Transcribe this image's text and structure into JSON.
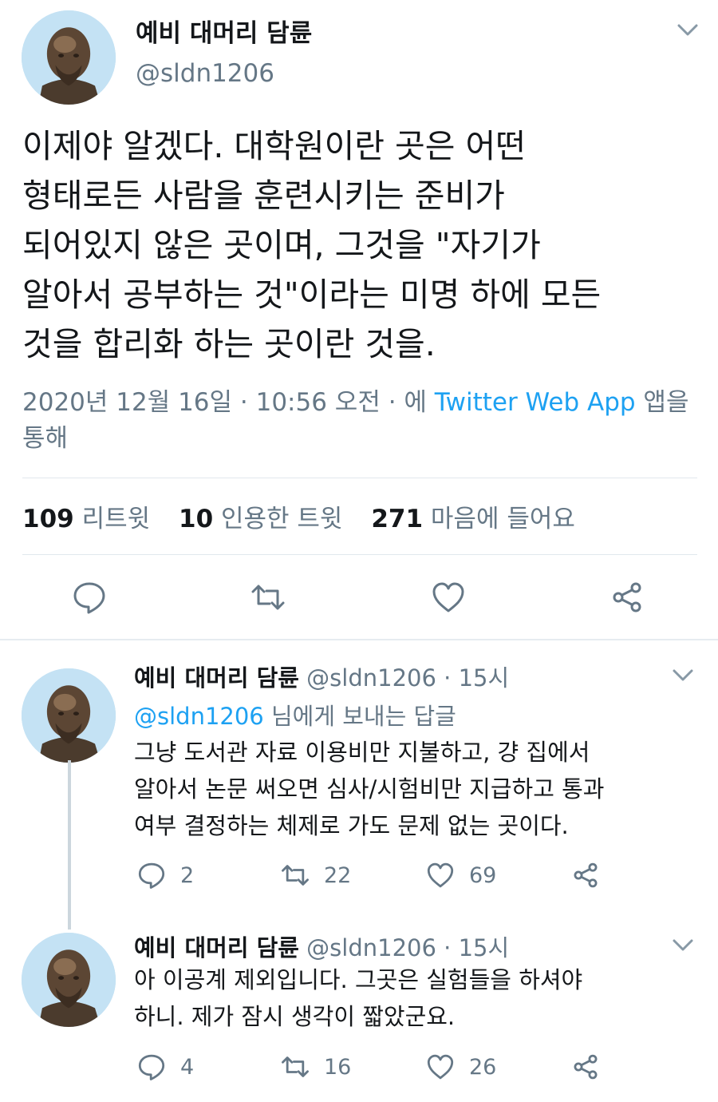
{
  "main_tweet": {
    "display_name": "예비 대머리 담륜",
    "handle": "@sldn1206",
    "text": "이제야 알겠다. 대학원이란 곳은 어떤\n형태로든 사람을 훈련시키는 준비가\n되어있지 않은 곳이며, 그것을 \"자기가\n알아서 공부하는 것\"이라는 미명 하에 모든\n것을 합리화 하는 곳이란 것을.",
    "timestamp": "2020년 12월 16일 · 10:56 오전 · 에",
    "source_app": "Twitter Web App",
    "source_suffix": "앱을",
    "source_suffix2": "통해",
    "stats": {
      "retweets_count": "109",
      "retweets_label": "리트윗",
      "quotes_count": "10",
      "quotes_label": "인용한 트윗",
      "likes_count": "271",
      "likes_label": "마음에 들어요"
    }
  },
  "replies": [
    {
      "display_name": "예비 대머리 담륜",
      "handle": "@sldn1206",
      "time": "· 15시",
      "replying_to_handle": "@sldn1206",
      "replying_to_suffix": "님에게 보내는 답글",
      "text": "그냥 도서관 자료 이용비만 지불하고, 걍 집에서\n알아서 논문 써오면 심사/시험비만 지급하고 통과\n여부 결정하는 체제로 가도 문제 없는 곳이다.",
      "reply_count": "2",
      "retweet_count": "22",
      "like_count": "69"
    },
    {
      "display_name": "예비 대머리 담륜",
      "handle": "@sldn1206",
      "time": "· 15시",
      "text": "아 이공계 제외입니다. 그곳은 실험들을 하셔야\n하니. 제가 잠시 생각이 짧았군요.",
      "reply_count": "4",
      "retweet_count": "16",
      "like_count": "26"
    }
  ],
  "colors": {
    "link": "#1da1f2",
    "secondary_text": "#657786",
    "primary_text": "#14171a",
    "divider": "#e1e8ed"
  },
  "icons": {
    "reply": "comment-bubble-icon",
    "retweet": "retweet-icon",
    "like": "heart-icon",
    "share": "share-icon",
    "menu": "chevron-down-icon"
  }
}
